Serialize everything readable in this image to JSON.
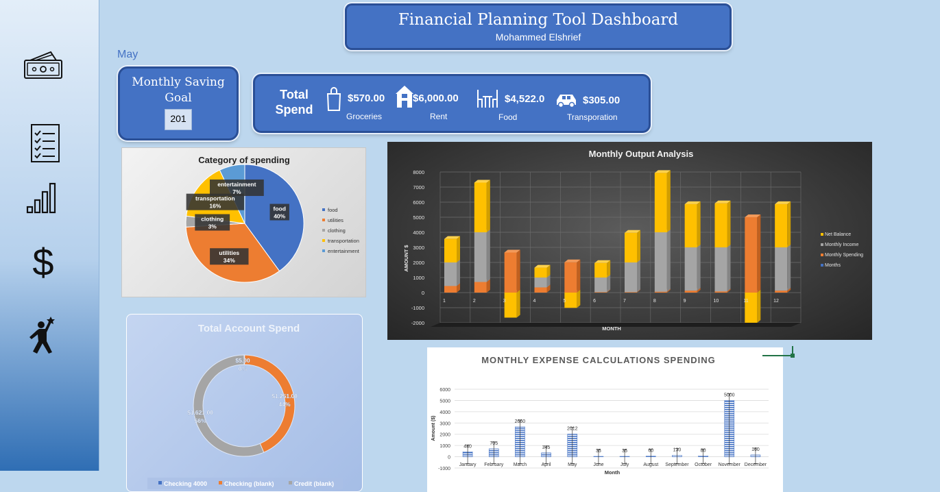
{
  "header": {
    "title": "Financial Planning Tool Dashboard",
    "subtitle": "Mohammed Elshrief"
  },
  "month": "May",
  "saving_goal": {
    "label": "Monthly Saving Goal",
    "value": "201"
  },
  "total_spend": {
    "title": "Total Spend",
    "items": [
      {
        "icon": "shopping-bag-icon",
        "value": "$570.00",
        "label": "Groceries"
      },
      {
        "icon": "house-icon",
        "value": "$6,000.00",
        "label": "Rent"
      },
      {
        "icon": "dining-table-icon",
        "value": "$4,522.0",
        "label": "Food"
      },
      {
        "icon": "car-icon",
        "value": "$305.00",
        "label": "Transporation"
      }
    ]
  },
  "sidebar": {
    "icons": [
      "money-icon",
      "checklist-icon",
      "bar-chart-icon",
      "dollar-icon",
      "goal-achiever-icon"
    ]
  },
  "colors": {
    "blue": "#4472c4",
    "orange": "#ed7d31",
    "gray": "#a5a5a5",
    "yellow": "#ffc000",
    "lightblue": "#5b9bd5"
  },
  "chart_data": [
    {
      "type": "pie",
      "title": "Category of spending",
      "categories": [
        "food",
        "utilities",
        "clothing",
        "transportation",
        "entertainment"
      ],
      "values": [
        40,
        34,
        3,
        16,
        7
      ],
      "data_labels": [
        "food\n40%",
        "utilities\n34%",
        "clothing\n3%",
        "transportation\n16%",
        "entertainment\n7%"
      ],
      "legend": "right"
    },
    {
      "type": "pie",
      "title": "Total Account Spend",
      "donut": true,
      "categories": [
        "Checking 4000",
        "Checking (blank)",
        "Credit (blank)"
      ],
      "values": [
        5.0,
        1251.0,
        1621.0
      ],
      "data_labels": [
        [
          "$5.00",
          "0%"
        ],
        [
          "$1,251.00",
          "44%"
        ],
        [
          "$1,621.00",
          "56%"
        ]
      ],
      "legend": "bottom"
    },
    {
      "type": "bar",
      "title": "Monthly Output Analysis",
      "stacked": true,
      "three_d": true,
      "xlabel": "MONTH",
      "ylabel": "AMOUNT $",
      "categories": [
        "1",
        "2",
        "3",
        "4",
        "5",
        "6",
        "7",
        "8",
        "9",
        "10",
        "11",
        "12"
      ],
      "ylim": [
        -2000,
        8000
      ],
      "yticks": [
        -2000,
        -1000,
        0,
        1000,
        2000,
        3000,
        4000,
        5000,
        6000,
        7000,
        8000
      ],
      "series": [
        {
          "name": "Net Balance",
          "values": [
            1560,
            3295,
            -1660,
            655,
            -1012,
            965,
            1965,
            3940,
            2870,
            2920,
            -2000,
            2870
          ]
        },
        {
          "name": "Monthly Income",
          "values": [
            2000,
            4000,
            1000,
            1000,
            1000,
            1000,
            2000,
            4000,
            3000,
            3000,
            3000,
            3000
          ]
        },
        {
          "name": "Monthly Spending",
          "values": [
            440,
            705,
            2660,
            345,
            2012,
            35,
            35,
            60,
            130,
            80,
            5000,
            130
          ]
        },
        {
          "name": "Months",
          "values": [
            1,
            2,
            3,
            4,
            5,
            6,
            7,
            8,
            9,
            10,
            11,
            12
          ]
        }
      ],
      "legend": "right"
    },
    {
      "type": "bar",
      "title": "MONTHLY EXPENSE CALCULATIONS SPENDING",
      "xlabel": "Month",
      "ylabel": "Amount ($)",
      "categories": [
        "January",
        "February",
        "March",
        "April",
        "May",
        "June",
        "July",
        "August",
        "September",
        "October",
        "November",
        "December"
      ],
      "values": [
        440,
        705,
        2660,
        345,
        2012,
        35,
        35,
        60,
        130,
        80,
        5000,
        160
      ],
      "ylim": [
        -1000,
        6000
      ],
      "yticks": [
        -1000,
        0,
        1000,
        2000,
        3000,
        4000,
        5000,
        6000
      ],
      "error_bars": true
    }
  ]
}
